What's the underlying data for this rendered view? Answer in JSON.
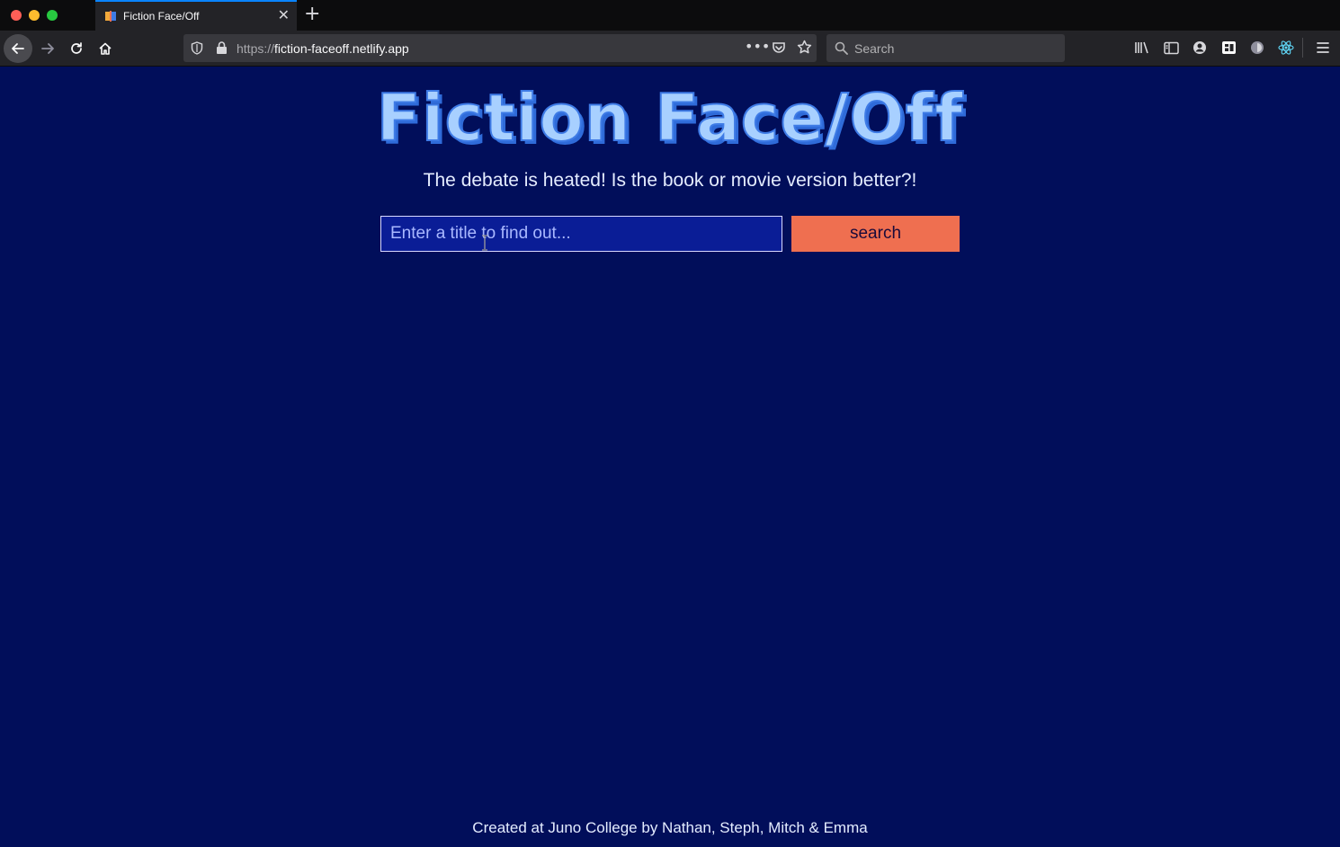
{
  "browser": {
    "tab": {
      "title": "Fiction Face/Off"
    },
    "url": {
      "scheme": "https://",
      "host": "fiction-faceoff.netlify.app"
    },
    "search_placeholder": "Search",
    "new_tab_label": "+",
    "more_label": "•••",
    "close_label": "✕",
    "icons": [
      "back-icon",
      "forward-icon",
      "reload-icon",
      "home-icon",
      "shield-icon",
      "lock-icon",
      "page-actions-icon",
      "pocket-icon",
      "bookmark-star-icon",
      "search-icon",
      "library-icon",
      "sidebar-icon",
      "account-icon",
      "extension-icon",
      "react-devtools-icon",
      "menu-icon"
    ]
  },
  "page": {
    "title": "Fiction Face/Off",
    "subtitle": "The debate is heated! Is the book or movie version better?!",
    "search": {
      "placeholder": "Enter a title to find out...",
      "button_label": "search"
    },
    "footer": "Created at Juno College by Nathan, Steph, Mitch & Emma"
  },
  "colors": {
    "page_background": "#010e5a",
    "title_fill": "#a8d0ff",
    "title_outline": "#3e7be6",
    "button": "#ef6f50",
    "input_background": "#0a1d96"
  }
}
